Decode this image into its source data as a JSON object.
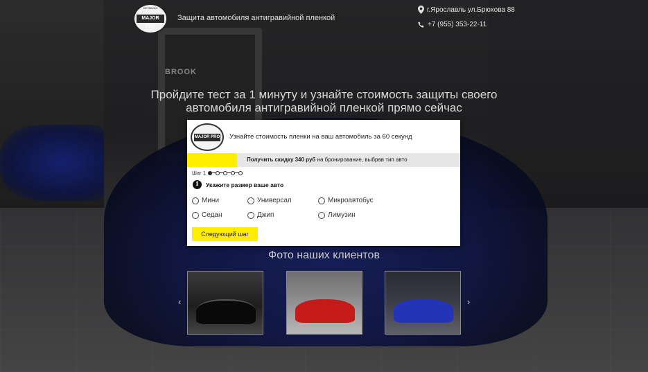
{
  "header": {
    "logo_text": "MAJOR PRO",
    "logo_arc_text": "DETAILING",
    "tagline": "Защита автомобиля антигравийной пленкой",
    "address": "г.Ярославль ул.Брюхова 88",
    "phone": "+7 (955) 353-22-11"
  },
  "hero": {
    "headline": "Пройдите тест за 1 минуту и узнайте стоимость защиты своего автомобиля антигравийной пленкой прямо сейчас",
    "background_sign": "BROOK"
  },
  "quiz": {
    "title": "Узнайте стоимость пленки на ваш автомобиль за 60 секунд",
    "promo_bold": "Получить скидку 340 руб",
    "promo_rest": " на бронирование, выбрав тип авто",
    "step_label": "Шаг 1",
    "total_steps": 5,
    "current_step": 1,
    "question": "Укажите размер ваше авто",
    "options": [
      "Мини",
      "Универсал",
      "Микроавтобус",
      "Седан",
      "Джип",
      "Лимузин"
    ],
    "next_button": "Следующий шаг"
  },
  "gallery": {
    "title": "Фото наших клиентов",
    "prev_arrow": "‹",
    "next_arrow": "›"
  },
  "colors": {
    "accent_yellow": "#ffee00",
    "promo_gray": "#e6e6e6"
  }
}
